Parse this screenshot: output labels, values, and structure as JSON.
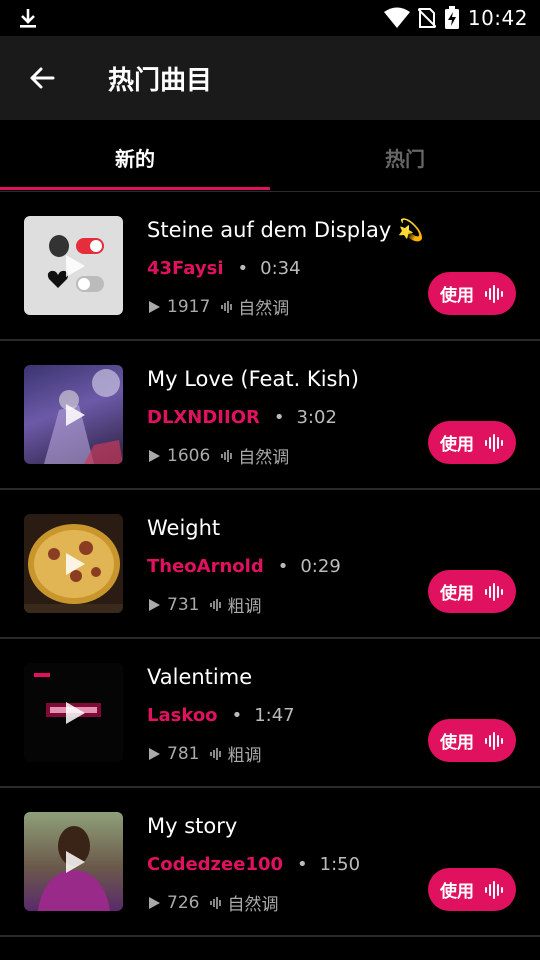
{
  "status_bar": {
    "time": "10:42"
  },
  "app_bar": {
    "title": "热门曲目"
  },
  "tabs": [
    {
      "label": "新的"
    },
    {
      "label": "热门"
    }
  ],
  "songs": [
    {
      "title": "Steine auf dem Display 💫",
      "artist": "43Faysi",
      "duration": "0:34",
      "plays": "1917",
      "tag": "自然调",
      "use_label": "使用"
    },
    {
      "title": "My Love (Feat. Kish)",
      "artist": "DLXNDIIOR",
      "duration": "3:02",
      "plays": "1606",
      "tag": "自然调",
      "use_label": "使用"
    },
    {
      "title": "Weight",
      "artist": "TheoArnold",
      "duration": "0:29",
      "plays": "731",
      "tag": "粗调",
      "use_label": "使用"
    },
    {
      "title": "Valentime",
      "artist": "Laskoo",
      "duration": "1:47",
      "plays": "781",
      "tag": "粗调",
      "use_label": "使用"
    },
    {
      "title": "My story",
      "artist": "Codedzee100",
      "duration": "1:50",
      "plays": "726",
      "tag": "自然调",
      "use_label": "使用"
    }
  ],
  "colors": {
    "accent": "#e0115f",
    "background": "#000000",
    "app_bar": "#1a1a1a"
  },
  "icons": {
    "back": "arrow-left-icon",
    "download": "download-icon",
    "play": "play-icon",
    "waveform": "waveform-icon"
  }
}
